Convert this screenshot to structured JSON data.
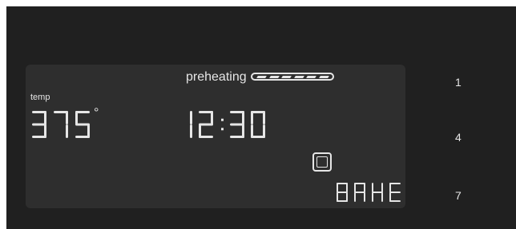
{
  "display": {
    "preheat_label": "preheating",
    "preheat_progress": 1.0,
    "temp_label": "temp",
    "temperature": "375",
    "degree_symbol": "°",
    "timer": "12:30",
    "mode": "BAKE"
  },
  "keypad": {
    "keys": [
      "1",
      "4",
      "7"
    ]
  },
  "colors": {
    "background": "#202020",
    "panel": "#2e2e2e",
    "segment": "#e6e6e6"
  }
}
